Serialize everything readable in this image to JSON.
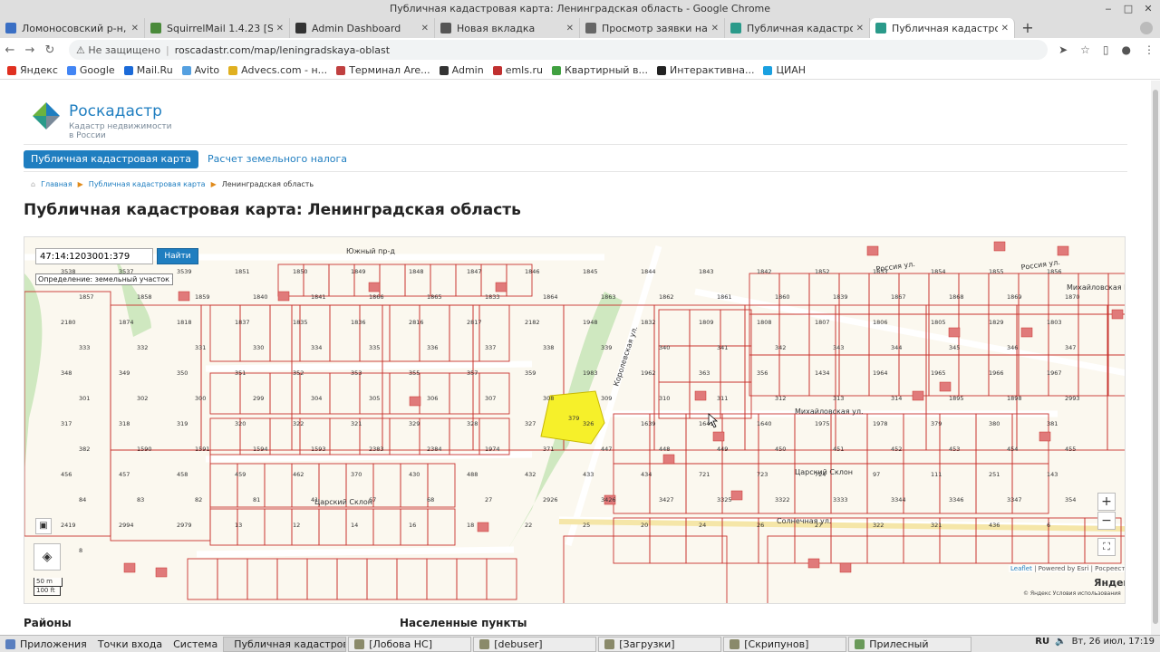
{
  "window": {
    "title": "Публичная кадастровая карта: Ленинградская область - Google Chrome"
  },
  "tabs": [
    {
      "label": "Ломоносовский р-н, Цар",
      "color": "#3a6fc4"
    },
    {
      "label": "SquirrelMail 1.4.23 [SVN]",
      "color": "#4a8a3a"
    },
    {
      "label": "Admin Dashboard",
      "color": "#333333"
    },
    {
      "label": "Новая вкладка",
      "color": "#555555"
    },
    {
      "label": "Просмотр заявки на ПЛА",
      "color": "#666666"
    },
    {
      "label": "Публичная кадастровая",
      "color": "#2a9a8a"
    },
    {
      "label": "Публичная кадастровая",
      "color": "#2a9a8a"
    }
  ],
  "address": {
    "insecure": "Не защищено",
    "url": "roscadastr.com/map/leningradskaya-oblast"
  },
  "bookmarks": [
    {
      "label": "Яндекс",
      "color": "#e03020"
    },
    {
      "label": "Google",
      "color": "#4285f4"
    },
    {
      "label": "Mail.Ru",
      "color": "#1b6ad8"
    },
    {
      "label": "Avito",
      "color": "#55a0e0"
    },
    {
      "label": "Advecs.com - н...",
      "color": "#e0b020"
    },
    {
      "label": "Терминал Are...",
      "color": "#c04040"
    },
    {
      "label": "Admin",
      "color": "#333333"
    },
    {
      "label": "emls.ru",
      "color": "#c03030"
    },
    {
      "label": "Квартирный в...",
      "color": "#40a040"
    },
    {
      "label": "Интерактивна...",
      "color": "#222222"
    },
    {
      "label": "ЦИАН",
      "color": "#1aa0e0"
    }
  ],
  "logo": {
    "brand": "Роскадастр",
    "sub1": "Кадастр недвижимости",
    "sub2": "в России"
  },
  "nav": {
    "active": "Публичная кадастровая карта",
    "link": "Расчет земельного налога"
  },
  "breadcrumb": {
    "home": "Главная",
    "map": "Публичная кадастровая карта",
    "current": "Ленинградская область"
  },
  "page_title": "Публичная кадастровая карта: Ленинградская область",
  "map": {
    "search_value": "47:14:1203001:379",
    "search_button": "Найти",
    "define_label": "Определение:",
    "define_value": "земельный участок",
    "streets": {
      "yuzhny": "Южный пр-д",
      "rossiya": "Россия ул.",
      "rossiya2": "Россия ул.",
      "mikh": "Михайловская ул.",
      "solnech": "Солнечная ул.",
      "tsar": "Царский Склон",
      "tsar2": "Царский Склон",
      "mikhgorka": "Михайловская Горка",
      "korolev": "Королевская ул."
    },
    "parcels": [
      "3538",
      "3537",
      "3539",
      "1851",
      "1850",
      "1849",
      "1848",
      "1847",
      "1846",
      "1845",
      "1844",
      "1843",
      "1842",
      "1852",
      "1853",
      "1854",
      "1855",
      "1856",
      "1857",
      "1858",
      "1859",
      "1840",
      "1841",
      "1866",
      "1865",
      "1833",
      "1864",
      "1863",
      "1862",
      "1861",
      "1860",
      "1839",
      "1867",
      "1868",
      "1869",
      "1870",
      "2180",
      "1874",
      "1818",
      "1837",
      "1835",
      "1836",
      "2816",
      "2817",
      "2182",
      "1948",
      "1832",
      "1809",
      "1808",
      "1807",
      "1806",
      "1805",
      "1829",
      "1803",
      "333",
      "332",
      "331",
      "330",
      "334",
      "335",
      "336",
      "337",
      "338",
      "339",
      "340",
      "341",
      "342",
      "343",
      "344",
      "345",
      "346",
      "347",
      "348",
      "349",
      "350",
      "351",
      "352",
      "353",
      "355",
      "357",
      "359",
      "1983",
      "1962",
      "363",
      "356",
      "1434",
      "1964",
      "1965",
      "1966",
      "1967",
      "301",
      "302",
      "300",
      "299",
      "304",
      "305",
      "306",
      "307",
      "308",
      "309",
      "310",
      "311",
      "312",
      "313",
      "314",
      "1895",
      "1898",
      "2993",
      "317",
      "318",
      "319",
      "320",
      "322",
      "321",
      "329",
      "328",
      "327",
      "326",
      "1639",
      "1641",
      "1640",
      "1975",
      "1978",
      "379",
      "380",
      "381",
      "382",
      "1590",
      "1591",
      "1594",
      "1593",
      "2383",
      "2384",
      "1974",
      "371",
      "447",
      "448",
      "449",
      "450",
      "451",
      "452",
      "453",
      "454",
      "455",
      "456",
      "457",
      "458",
      "459",
      "462",
      "370",
      "430",
      "488",
      "432",
      "433",
      "434",
      "721",
      "723",
      "724",
      "97",
      "111",
      "251",
      "143",
      "84",
      "83",
      "82",
      "81",
      "41",
      "67",
      "68",
      "27",
      "2926",
      "3426",
      "3427",
      "3325",
      "3322",
      "3333",
      "3344",
      "3346",
      "3347",
      "354",
      "2419",
      "2994",
      "2979",
      "13",
      "12",
      "14",
      "16",
      "18",
      "22",
      "25",
      "20",
      "24",
      "26",
      "27",
      "322",
      "321",
      "436",
      "6",
      "8"
    ],
    "parcel_379": "379",
    "attribution": {
      "leaflet": "Leaflet",
      "rest": " | Powered by Esri | Росреестр"
    },
    "yandex": "Яндекс",
    "yandex_terms": "© Яндекс  Условия использования",
    "scale_top": "50 m",
    "scale_bottom": "100 ft",
    "zoom_in": "+",
    "zoom_out": "−"
  },
  "sections": {
    "rayony": "Районы",
    "punkty": "Населенные пункты"
  },
  "taskbar": {
    "apps": "Приложения",
    "places": "Точки входа",
    "system": "Система",
    "windows": [
      {
        "label": "Публичная кадастрова...",
        "color": "#4285f4",
        "active": true
      },
      {
        "label": "[Лобова НС]",
        "color": "#8a8a6a",
        "active": false
      },
      {
        "label": "[debuser]",
        "color": "#8a8a6a",
        "active": false
      },
      {
        "label": "[Загрузки]",
        "color": "#8a8a6a",
        "active": false
      },
      {
        "label": "[Скрипунов]",
        "color": "#8a8a6a",
        "active": false
      },
      {
        "label": "Прилесный",
        "color": "#6a9a5a",
        "active": false
      }
    ],
    "lang": "RU",
    "clock": "Вт, 26 июл, 17:19"
  }
}
